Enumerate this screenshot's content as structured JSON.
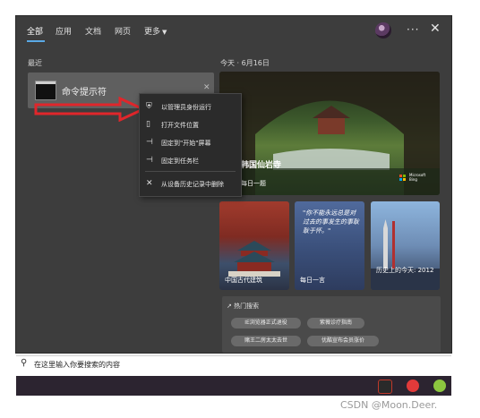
{
  "tabs": [
    {
      "label": "全部"
    },
    {
      "label": "应用"
    },
    {
      "label": "文档"
    },
    {
      "label": "网页"
    },
    {
      "label": "更多"
    }
  ],
  "recent": {
    "label": "最近",
    "app_name": "命令提示符"
  },
  "context_menu": [
    {
      "label": "以管理员身份运行",
      "icon": "shield-run-icon"
    },
    {
      "label": "打开文件位置",
      "icon": "folder-icon"
    },
    {
      "label": "固定到\"开始\"屏幕",
      "icon": "pin-icon"
    },
    {
      "label": "固定到任务栏",
      "icon": "pin-icon"
    },
    {
      "label": "从设备历史记录中删除",
      "icon": "close-icon"
    }
  ],
  "today": {
    "label": "今天 · 6月16日",
    "hero_title": "韩国仙岩寺",
    "hero_sub": "每日一题",
    "brand_line1": "Microsoft",
    "brand_line2": "Bing"
  },
  "cards": [
    {
      "label": "中国古代建筑"
    },
    {
      "label": "每日一言",
      "quote": "\"你不能永远总是对过去的事发生的事耿耿于怀。\""
    },
    {
      "label": "历史上的今天: 2012"
    }
  ],
  "hot": {
    "title": "热门搜索",
    "chips": [
      "IE浏览器正式退役",
      "紫薇诊疗指南",
      "赌王二房太太去世",
      "优酷宣布会员涨价"
    ]
  },
  "search": {
    "placeholder": "在这里输入你要搜索的内容"
  },
  "watermark": "CSDN @Moon.Deer.",
  "colors": {
    "accent": "#5aa9e6",
    "arrow": "#e0262b"
  }
}
